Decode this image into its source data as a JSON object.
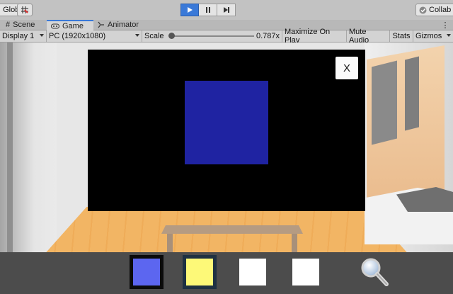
{
  "toolbar": {
    "global_label": "Global",
    "collab_label": "Collab"
  },
  "tabs": [
    {
      "label": "Scene",
      "icon": "hash-icon"
    },
    {
      "label": "Game",
      "icon": "gamepad-icon"
    },
    {
      "label": "Animator",
      "icon": "animator-icon"
    }
  ],
  "gamebar": {
    "display": "Display 1",
    "resolution": "PC (1920x1080)",
    "scale_label": "Scale",
    "scale_value": "0.787x",
    "maximize": "Maximize On Play",
    "mute": "Mute Audio",
    "stats": "Stats",
    "gizmos": "Gizmos"
  },
  "popup": {
    "close_label": "X",
    "preview_color": "#1f23a2"
  },
  "swatches": [
    {
      "color": "#5c66f0",
      "selected": true
    },
    {
      "color": "#fdf978",
      "selected": false
    },
    {
      "color": "#ffffff",
      "selected": false
    },
    {
      "color": "#ffffff",
      "selected": false
    }
  ],
  "accent_color": "#3a79d8"
}
